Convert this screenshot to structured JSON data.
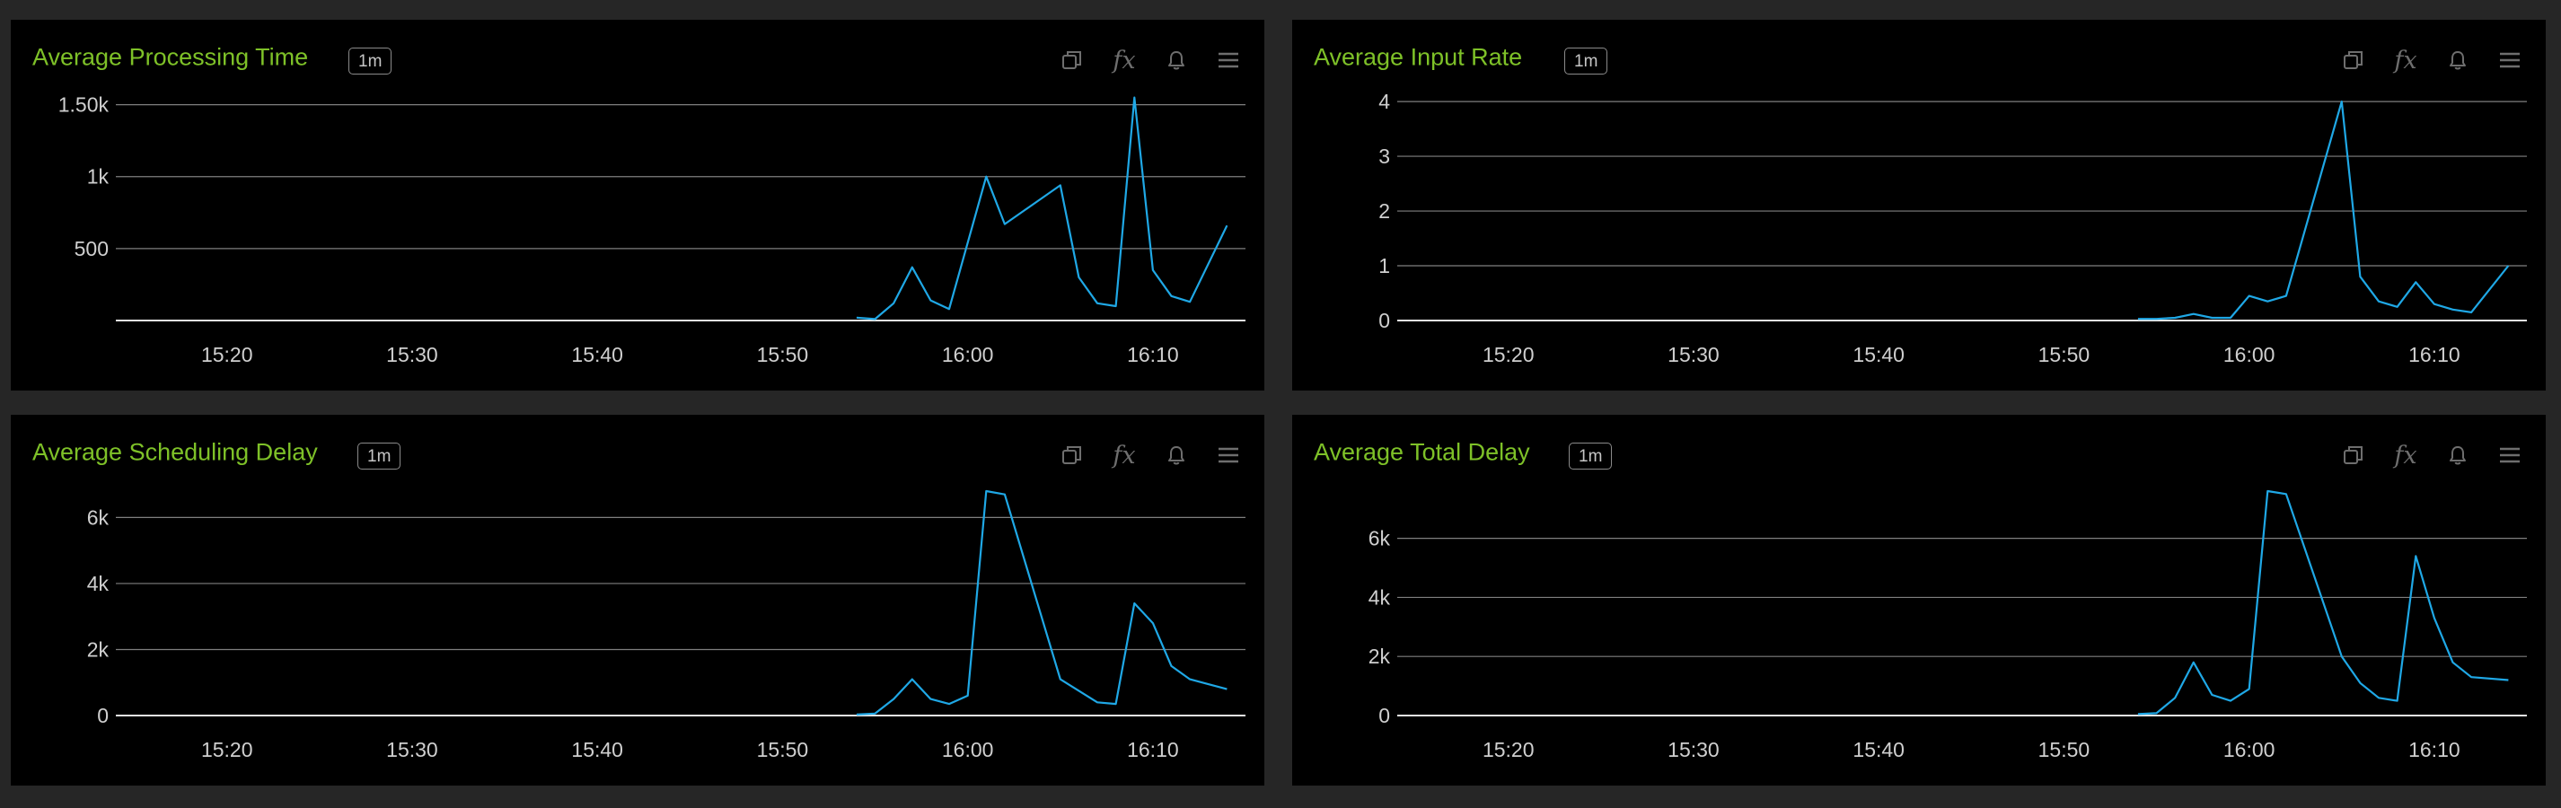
{
  "panels": [
    {
      "id": "avg-processing-time",
      "title": "Average Processing Time",
      "interval": "1m",
      "tools": [
        "copy-icon",
        "fx-icon",
        "bell-icon",
        "menu-icon"
      ],
      "chart_data": {
        "type": "line",
        "title": "Average Processing Time",
        "xlabel": "",
        "ylabel": "",
        "x_ticks": [
          "15:20",
          "15:30",
          "15:40",
          "15:50",
          "16:00",
          "16:10"
        ],
        "y_ticks": [
          {
            "value": 500,
            "label": "500"
          },
          {
            "value": 1000,
            "label": "1k"
          },
          {
            "value": 1500,
            "label": "1.50k"
          }
        ],
        "xlim": [
          "15:14",
          "16:15"
        ],
        "ylim": [
          0,
          1560
        ],
        "grid": true,
        "series": [
          {
            "color": "#1fa8e6",
            "points": [
              [
                "15:54",
                20
              ],
              [
                "15:55",
                10
              ],
              [
                "15:56",
                120
              ],
              [
                "15:57",
                370
              ],
              [
                "15:58",
                140
              ],
              [
                "15:59",
                80
              ],
              [
                "16:01",
                1000
              ],
              [
                "16:02",
                670
              ],
              [
                "16:05",
                940
              ],
              [
                "16:06",
                300
              ],
              [
                "16:07",
                120
              ],
              [
                "16:08",
                100
              ],
              [
                "16:09",
                1550
              ],
              [
                "16:10",
                350
              ],
              [
                "16:11",
                170
              ],
              [
                "16:12",
                130
              ],
              [
                "16:14",
                660
              ]
            ]
          }
        ]
      }
    },
    {
      "id": "avg-input-rate",
      "title": "Average Input Rate",
      "interval": "1m",
      "tools": [
        "copy-icon",
        "fx-icon",
        "bell-icon",
        "menu-icon"
      ],
      "chart_data": {
        "type": "line",
        "title": "Average Input Rate",
        "xlabel": "",
        "ylabel": "",
        "x_ticks": [
          "15:20",
          "15:30",
          "15:40",
          "15:50",
          "16:00",
          "16:10"
        ],
        "y_ticks": [
          {
            "value": 0,
            "label": "0"
          },
          {
            "value": 1,
            "label": "1"
          },
          {
            "value": 2,
            "label": "2"
          },
          {
            "value": 3,
            "label": "3"
          },
          {
            "value": 4,
            "label": "4"
          }
        ],
        "xlim": [
          "15:14",
          "16:15"
        ],
        "ylim": [
          0,
          4.1
        ],
        "grid": true,
        "series": [
          {
            "color": "#1fa8e6",
            "points": [
              [
                "15:54",
                0.03
              ],
              [
                "15:55",
                0.03
              ],
              [
                "15:56",
                0.05
              ],
              [
                "15:57",
                0.12
              ],
              [
                "15:58",
                0.05
              ],
              [
                "15:59",
                0.05
              ],
              [
                "16:00",
                0.45
              ],
              [
                "16:01",
                0.35
              ],
              [
                "16:02",
                0.45
              ],
              [
                "16:05",
                4.0
              ],
              [
                "16:06",
                0.8
              ],
              [
                "16:07",
                0.35
              ],
              [
                "16:08",
                0.25
              ],
              [
                "16:09",
                0.7
              ],
              [
                "16:10",
                0.3
              ],
              [
                "16:11",
                0.2
              ],
              [
                "16:12",
                0.15
              ],
              [
                "16:14",
                1.0
              ]
            ]
          }
        ]
      }
    },
    {
      "id": "avg-scheduling-delay",
      "title": "Average Scheduling Delay",
      "interval": "1m",
      "tools": [
        "copy-icon",
        "fx-icon",
        "bell-icon",
        "menu-icon"
      ],
      "chart_data": {
        "type": "line",
        "title": "Average Scheduling Delay",
        "xlabel": "",
        "ylabel": "",
        "x_ticks": [
          "15:20",
          "15:30",
          "15:40",
          "15:50",
          "16:00",
          "16:10"
        ],
        "y_ticks": [
          {
            "value": 0,
            "label": "0"
          },
          {
            "value": 2000,
            "label": "2k"
          },
          {
            "value": 4000,
            "label": "4k"
          },
          {
            "value": 6000,
            "label": "6k"
          }
        ],
        "xlim": [
          "15:14",
          "16:15"
        ],
        "ylim": [
          0,
          6800
        ],
        "grid": true,
        "series": [
          {
            "color": "#1fa8e6",
            "points": [
              [
                "15:54",
                30
              ],
              [
                "15:55",
                60
              ],
              [
                "15:56",
                500
              ],
              [
                "15:57",
                1100
              ],
              [
                "15:58",
                500
              ],
              [
                "15:59",
                350
              ],
              [
                "16:00",
                600
              ],
              [
                "16:01",
                6800
              ],
              [
                "16:02",
                6700
              ],
              [
                "16:05",
                1100
              ],
              [
                "16:07",
                400
              ],
              [
                "16:08",
                350
              ],
              [
                "16:09",
                3400
              ],
              [
                "16:10",
                2800
              ],
              [
                "16:11",
                1500
              ],
              [
                "16:12",
                1100
              ],
              [
                "16:14",
                800
              ]
            ]
          }
        ]
      }
    },
    {
      "id": "avg-total-delay",
      "title": "Average Total Delay",
      "interval": "1m",
      "tools": [
        "copy-icon",
        "fx-icon",
        "bell-icon",
        "menu-icon"
      ],
      "chart_data": {
        "type": "line",
        "title": "Average Total Delay",
        "xlabel": "",
        "ylabel": "",
        "x_ticks": [
          "15:20",
          "15:30",
          "15:40",
          "15:50",
          "16:00",
          "16:10"
        ],
        "y_ticks": [
          {
            "value": 0,
            "label": "0"
          },
          {
            "value": 2000,
            "label": "2k"
          },
          {
            "value": 4000,
            "label": "4k"
          },
          {
            "value": 6000,
            "label": "6k"
          }
        ],
        "xlim": [
          "15:14",
          "16:15"
        ],
        "ylim": [
          0,
          7600
        ],
        "grid": true,
        "series": [
          {
            "color": "#1fa8e6",
            "points": [
              [
                "15:54",
                50
              ],
              [
                "15:55",
                80
              ],
              [
                "15:56",
                600
              ],
              [
                "15:57",
                1800
              ],
              [
                "15:58",
                700
              ],
              [
                "15:59",
                500
              ],
              [
                "16:00",
                900
              ],
              [
                "16:01",
                7600
              ],
              [
                "16:02",
                7500
              ],
              [
                "16:05",
                2000
              ],
              [
                "16:06",
                1100
              ],
              [
                "16:07",
                600
              ],
              [
                "16:08",
                500
              ],
              [
                "16:09",
                5400
              ],
              [
                "16:10",
                3300
              ],
              [
                "16:11",
                1800
              ],
              [
                "16:12",
                1300
              ],
              [
                "16:14",
                1200
              ]
            ]
          }
        ]
      }
    }
  ]
}
